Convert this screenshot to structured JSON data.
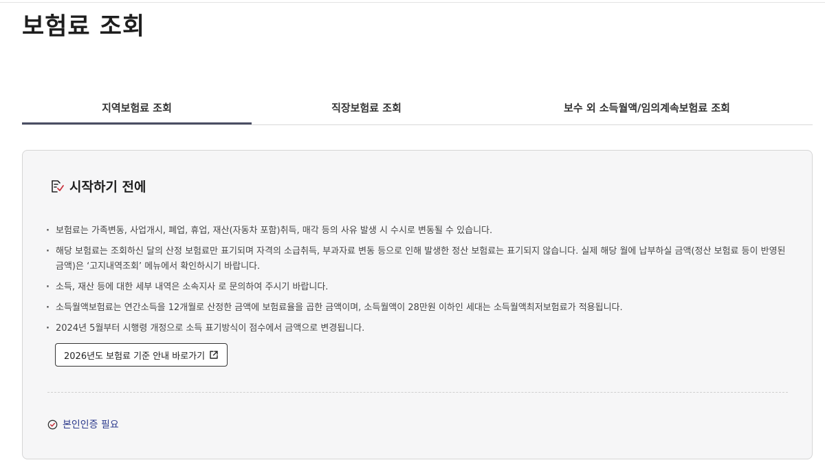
{
  "page": {
    "title": "보험료 조회"
  },
  "tabs": [
    {
      "label": "지역보험료 조회",
      "active": true
    },
    {
      "label": "직장보험료 조회",
      "active": false
    },
    {
      "label": "보수 외 소득월액/임의계속보험료 조회",
      "active": false
    }
  ],
  "panel": {
    "title": "시작하기 전에",
    "title_icon": "checklist-icon",
    "notices": [
      "보험료는 가족변동, 사업개시, 폐업, 휴업, 재산(자동차 포함)취득, 매각 등의 사유 발생 시 수시로 변동될 수 있습니다.",
      "해당 보험료는 조회하신 달의 산정 보험료만 표기되며 자격의 소급취득, 부과자료 변동 등으로 인해 발생한 정산 보험료는 표기되지 않습니다. 실제 해당 월에 납부하실 금액(정산 보험료 등이 반영된 금액)은 ‘고지내역조회’ 메뉴에서 확인하시기 바랍니다.",
      "소득, 재산 등에 대한 세부 내역은 소속지사 로 문의하여 주시기 바랍니다.",
      "소득월액보험료는 연간소득을 12개월로 산정한 금액에 보험료율을 곱한 금액이며, 소득월액이 28만원 이하인 세대는 소득월액최저보험료가 적용됩니다.",
      "2024년 5월부터 시행령 개정으로 소득 표기방식이 점수에서 금액으로 변경됩니다."
    ],
    "guide_button_label": "2026년도 보험료 기준 안내 바로가기",
    "guide_button_icon": "external-link-icon",
    "auth_label": "본인인증 필요",
    "auth_icon": "check-circle-icon"
  },
  "colors": {
    "accent": "#4a4d63",
    "link": "#2c3a8c",
    "check_red": "#c8323c",
    "panel_bg": "#f6f6f7"
  }
}
